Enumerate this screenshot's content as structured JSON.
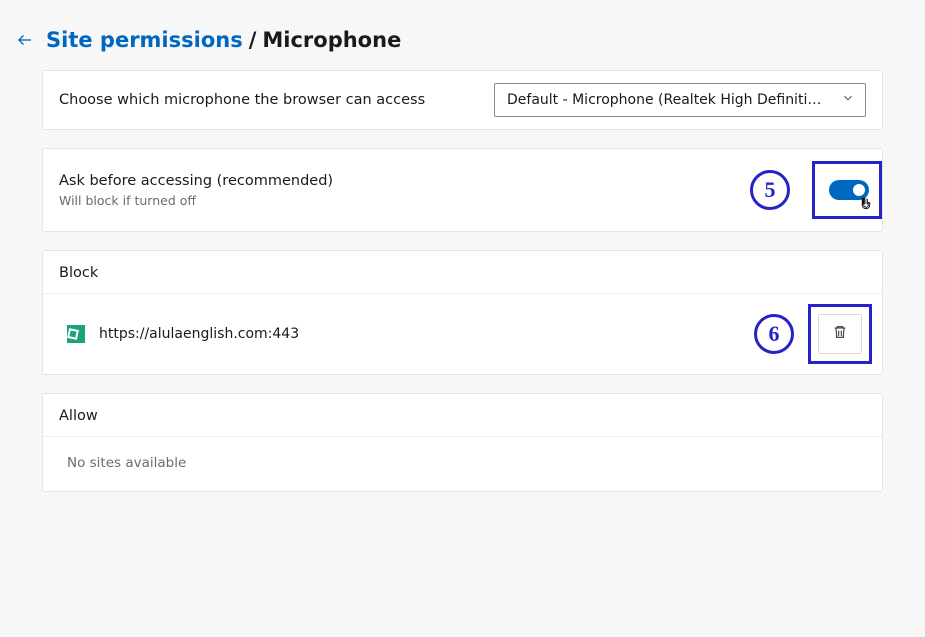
{
  "breadcrumb": {
    "parent": "Site permissions",
    "separator": "/",
    "current": "Microphone"
  },
  "microphone_choice": {
    "label": "Choose which microphone the browser can access",
    "selected": "Default - Microphone (Realtek High Definition Au..."
  },
  "ask_toggle": {
    "label": "Ask before accessing (recommended)",
    "sublabel": "Will block if turned off",
    "annotation_number": "5"
  },
  "block_section": {
    "title": "Block",
    "entries": [
      {
        "url": "https://alulaenglish.com:443"
      }
    ],
    "annotation_number": "6"
  },
  "allow_section": {
    "title": "Allow",
    "empty_text": "No sites available"
  }
}
